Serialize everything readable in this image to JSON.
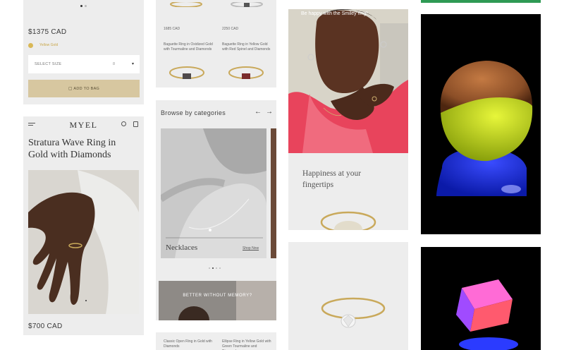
{
  "product_top": {
    "price": "$1375 CAD",
    "metal_label": "Yellow Gold",
    "size_select": {
      "label": "SELECT SIZE",
      "value": "",
      "marker": "8"
    },
    "add_to_bag": "ADD TO BAG"
  },
  "product_mobile": {
    "brand": "MYEL",
    "title_line1": "Stratura Wave Ring in",
    "title_line2": "Gold with Diamonds",
    "price": "$700 CAD"
  },
  "grid_top": {
    "left_price": "1685 CAD",
    "right_price": "2250 CAD",
    "left_name": "Baguette Ring in Oxidized Gold with Tourmaline and Diamonds",
    "right_name": "Baguette Ring in Yellow Gold with Red Spinel and Diamonds"
  },
  "categories": {
    "heading": "Browse by categories",
    "prev": "←",
    "next": "→",
    "slide_title": "Necklaces",
    "slide_link": "Shop Now",
    "banner": "BETTER WITHOUT MEMORY?"
  },
  "grid_bottom": {
    "left_name": "Classic Open Ring in Gold with Diamonds",
    "right_name": "Ellipse Ring in Yellow Gold with Green Tourmaline and Diamonds"
  },
  "smiley": {
    "caption": "Be happy with the Smiley ring!",
    "tagline_line1": "Happiness at your",
    "tagline_line2": "fingertips"
  },
  "colors": {
    "card_bg": "#ededed",
    "gold_button": "#d7c7a0",
    "green_strip": "#2e9a54"
  }
}
